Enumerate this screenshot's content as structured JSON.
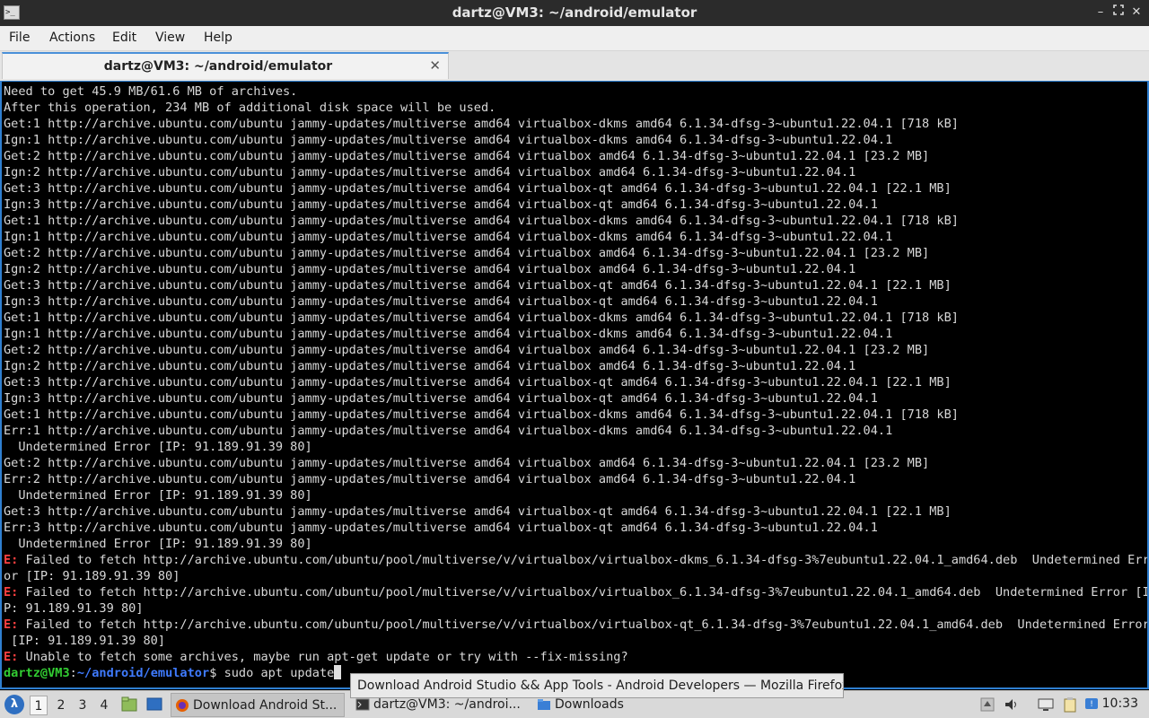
{
  "window": {
    "title": "dartz@VM3: ~/android/emulator",
    "icon": "terminal-icon"
  },
  "menubar": {
    "items": [
      "File",
      "Actions",
      "Edit",
      "View",
      "Help"
    ]
  },
  "tabs": [
    {
      "label": "dartz@VM3: ~/android/emulator",
      "close_icon": "close-icon"
    }
  ],
  "terminal": {
    "lines": [
      "Need to get 45.9 MB/61.6 MB of archives.",
      "After this operation, 234 MB of additional disk space will be used.",
      "Get:1 http://archive.ubuntu.com/ubuntu jammy-updates/multiverse amd64 virtualbox-dkms amd64 6.1.34-dfsg-3~ubuntu1.22.04.1 [718 kB]",
      "Ign:1 http://archive.ubuntu.com/ubuntu jammy-updates/multiverse amd64 virtualbox-dkms amd64 6.1.34-dfsg-3~ubuntu1.22.04.1",
      "Get:2 http://archive.ubuntu.com/ubuntu jammy-updates/multiverse amd64 virtualbox amd64 6.1.34-dfsg-3~ubuntu1.22.04.1 [23.2 MB]",
      "Ign:2 http://archive.ubuntu.com/ubuntu jammy-updates/multiverse amd64 virtualbox amd64 6.1.34-dfsg-3~ubuntu1.22.04.1",
      "Get:3 http://archive.ubuntu.com/ubuntu jammy-updates/multiverse amd64 virtualbox-qt amd64 6.1.34-dfsg-3~ubuntu1.22.04.1 [22.1 MB]",
      "Ign:3 http://archive.ubuntu.com/ubuntu jammy-updates/multiverse amd64 virtualbox-qt amd64 6.1.34-dfsg-3~ubuntu1.22.04.1",
      "Get:1 http://archive.ubuntu.com/ubuntu jammy-updates/multiverse amd64 virtualbox-dkms amd64 6.1.34-dfsg-3~ubuntu1.22.04.1 [718 kB]",
      "Ign:1 http://archive.ubuntu.com/ubuntu jammy-updates/multiverse amd64 virtualbox-dkms amd64 6.1.34-dfsg-3~ubuntu1.22.04.1",
      "Get:2 http://archive.ubuntu.com/ubuntu jammy-updates/multiverse amd64 virtualbox amd64 6.1.34-dfsg-3~ubuntu1.22.04.1 [23.2 MB]",
      "Ign:2 http://archive.ubuntu.com/ubuntu jammy-updates/multiverse amd64 virtualbox amd64 6.1.34-dfsg-3~ubuntu1.22.04.1",
      "Get:3 http://archive.ubuntu.com/ubuntu jammy-updates/multiverse amd64 virtualbox-qt amd64 6.1.34-dfsg-3~ubuntu1.22.04.1 [22.1 MB]",
      "Ign:3 http://archive.ubuntu.com/ubuntu jammy-updates/multiverse amd64 virtualbox-qt amd64 6.1.34-dfsg-3~ubuntu1.22.04.1",
      "Get:1 http://archive.ubuntu.com/ubuntu jammy-updates/multiverse amd64 virtualbox-dkms amd64 6.1.34-dfsg-3~ubuntu1.22.04.1 [718 kB]",
      "Ign:1 http://archive.ubuntu.com/ubuntu jammy-updates/multiverse amd64 virtualbox-dkms amd64 6.1.34-dfsg-3~ubuntu1.22.04.1",
      "Get:2 http://archive.ubuntu.com/ubuntu jammy-updates/multiverse amd64 virtualbox amd64 6.1.34-dfsg-3~ubuntu1.22.04.1 [23.2 MB]",
      "Ign:2 http://archive.ubuntu.com/ubuntu jammy-updates/multiverse amd64 virtualbox amd64 6.1.34-dfsg-3~ubuntu1.22.04.1",
      "Get:3 http://archive.ubuntu.com/ubuntu jammy-updates/multiverse amd64 virtualbox-qt amd64 6.1.34-dfsg-3~ubuntu1.22.04.1 [22.1 MB]",
      "Ign:3 http://archive.ubuntu.com/ubuntu jammy-updates/multiverse amd64 virtualbox-qt amd64 6.1.34-dfsg-3~ubuntu1.22.04.1",
      "Get:1 http://archive.ubuntu.com/ubuntu jammy-updates/multiverse amd64 virtualbox-dkms amd64 6.1.34-dfsg-3~ubuntu1.22.04.1 [718 kB]",
      "Err:1 http://archive.ubuntu.com/ubuntu jammy-updates/multiverse amd64 virtualbox-dkms amd64 6.1.34-dfsg-3~ubuntu1.22.04.1",
      "  Undetermined Error [IP: 91.189.91.39 80]",
      "Get:2 http://archive.ubuntu.com/ubuntu jammy-updates/multiverse amd64 virtualbox amd64 6.1.34-dfsg-3~ubuntu1.22.04.1 [23.2 MB]",
      "Err:2 http://archive.ubuntu.com/ubuntu jammy-updates/multiverse amd64 virtualbox amd64 6.1.34-dfsg-3~ubuntu1.22.04.1",
      "  Undetermined Error [IP: 91.189.91.39 80]",
      "Get:3 http://archive.ubuntu.com/ubuntu jammy-updates/multiverse amd64 virtualbox-qt amd64 6.1.34-dfsg-3~ubuntu1.22.04.1 [22.1 MB]",
      "Err:3 http://archive.ubuntu.com/ubuntu jammy-updates/multiverse amd64 virtualbox-qt amd64 6.1.34-dfsg-3~ubuntu1.22.04.1",
      "  Undetermined Error [IP: 91.189.91.39 80]",
      {
        "type": "err",
        "prefix": "E:",
        "text": " Failed to fetch http://archive.ubuntu.com/ubuntu/pool/multiverse/v/virtualbox/virtualbox-dkms_6.1.34-dfsg-3%7eubuntu1.22.04.1_amd64.deb  Undetermined Err"
      },
      "or [IP: 91.189.91.39 80]",
      {
        "type": "err",
        "prefix": "E:",
        "text": " Failed to fetch http://archive.ubuntu.com/ubuntu/pool/multiverse/v/virtualbox/virtualbox_6.1.34-dfsg-3%7eubuntu1.22.04.1_amd64.deb  Undetermined Error [I"
      },
      "P: 91.189.91.39 80]",
      {
        "type": "err",
        "prefix": "E:",
        "text": " Failed to fetch http://archive.ubuntu.com/ubuntu/pool/multiverse/v/virtualbox/virtualbox-qt_6.1.34-dfsg-3%7eubuntu1.22.04.1_amd64.deb  Undetermined Error"
      },
      " [IP: 91.189.91.39 80]",
      {
        "type": "err",
        "prefix": "E:",
        "text": " Unable to fetch some archives, maybe run apt-get update or try with --fix-missing?"
      }
    ],
    "prompt": {
      "user_host": "dartz@VM3",
      "separator": ":",
      "path": "~/android/emulator",
      "symbol": "$ ",
      "command": "sudo apt update"
    }
  },
  "tooltip": {
    "text": "Download Android Studio && App Tools - Android Developers — Mozilla Firefox"
  },
  "taskbar": {
    "menu_icon": "distro-menu-icon",
    "workspaces": [
      "1",
      "2",
      "3",
      "4"
    ],
    "active_workspace": "1",
    "launchers": [
      "file-manager-icon",
      "show-desktop-icon"
    ],
    "tasks": [
      {
        "label": "Download Android St...",
        "icon": "firefox-icon"
      },
      {
        "label": "dartz@VM3: ~/androi...",
        "icon": "terminal-icon"
      },
      {
        "label": "Downloads",
        "icon": "folder-icon"
      }
    ],
    "tray": [
      "eject-icon",
      "volume-icon",
      "display-icon",
      "clipboard-icon",
      "notification-icon"
    ],
    "clock": "10:33"
  },
  "colors": {
    "terminal_bg": "#000000",
    "terminal_fg": "#d8d8d8",
    "error": "#ff4040",
    "prompt_user": "#32cd32",
    "prompt_path": "#3f7bff",
    "focus_border": "#2f7fd0"
  }
}
